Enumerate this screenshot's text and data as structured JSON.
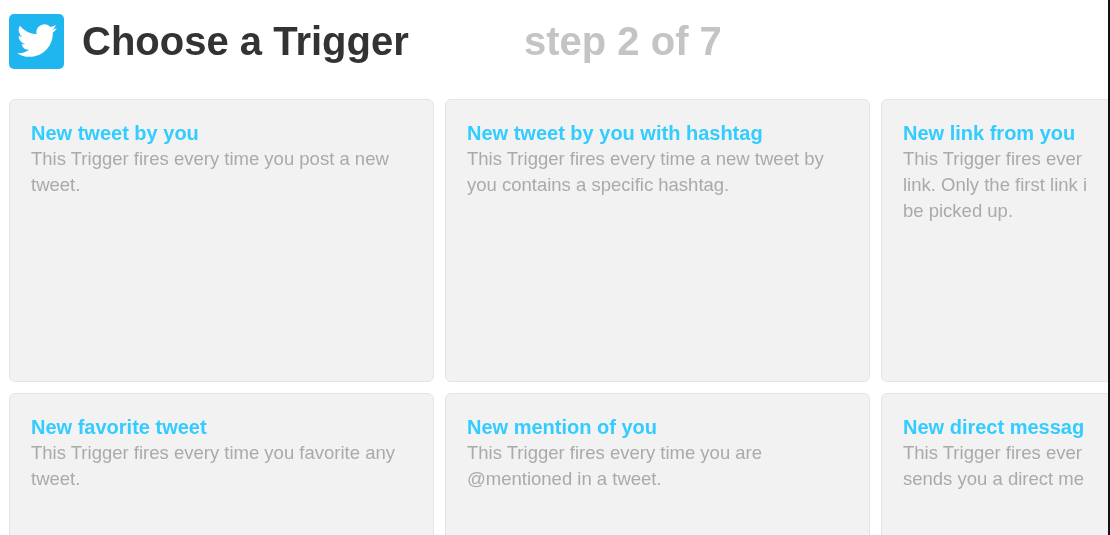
{
  "header": {
    "title": "Choose a Trigger",
    "step": "step 2 of 7"
  },
  "triggers": [
    {
      "title": "New tweet by you",
      "description": "This Trigger fires every time you post a new tweet."
    },
    {
      "title": "New tweet by you with hashtag",
      "description": "This Trigger fires every time a new tweet by you contains a specific hashtag."
    },
    {
      "title": "New link from you",
      "description": "This Trigger fires ever\nlink. Only the first link i\nbe picked up."
    },
    {
      "title": "New favorite tweet",
      "description": "This Trigger fires every time you favorite any tweet."
    },
    {
      "title": "New mention of you",
      "description": "This Trigger fires every time you are @mentioned in a tweet."
    },
    {
      "title": "New direct messag",
      "description": "This Trigger fires ever\nsends you a direct me"
    }
  ]
}
